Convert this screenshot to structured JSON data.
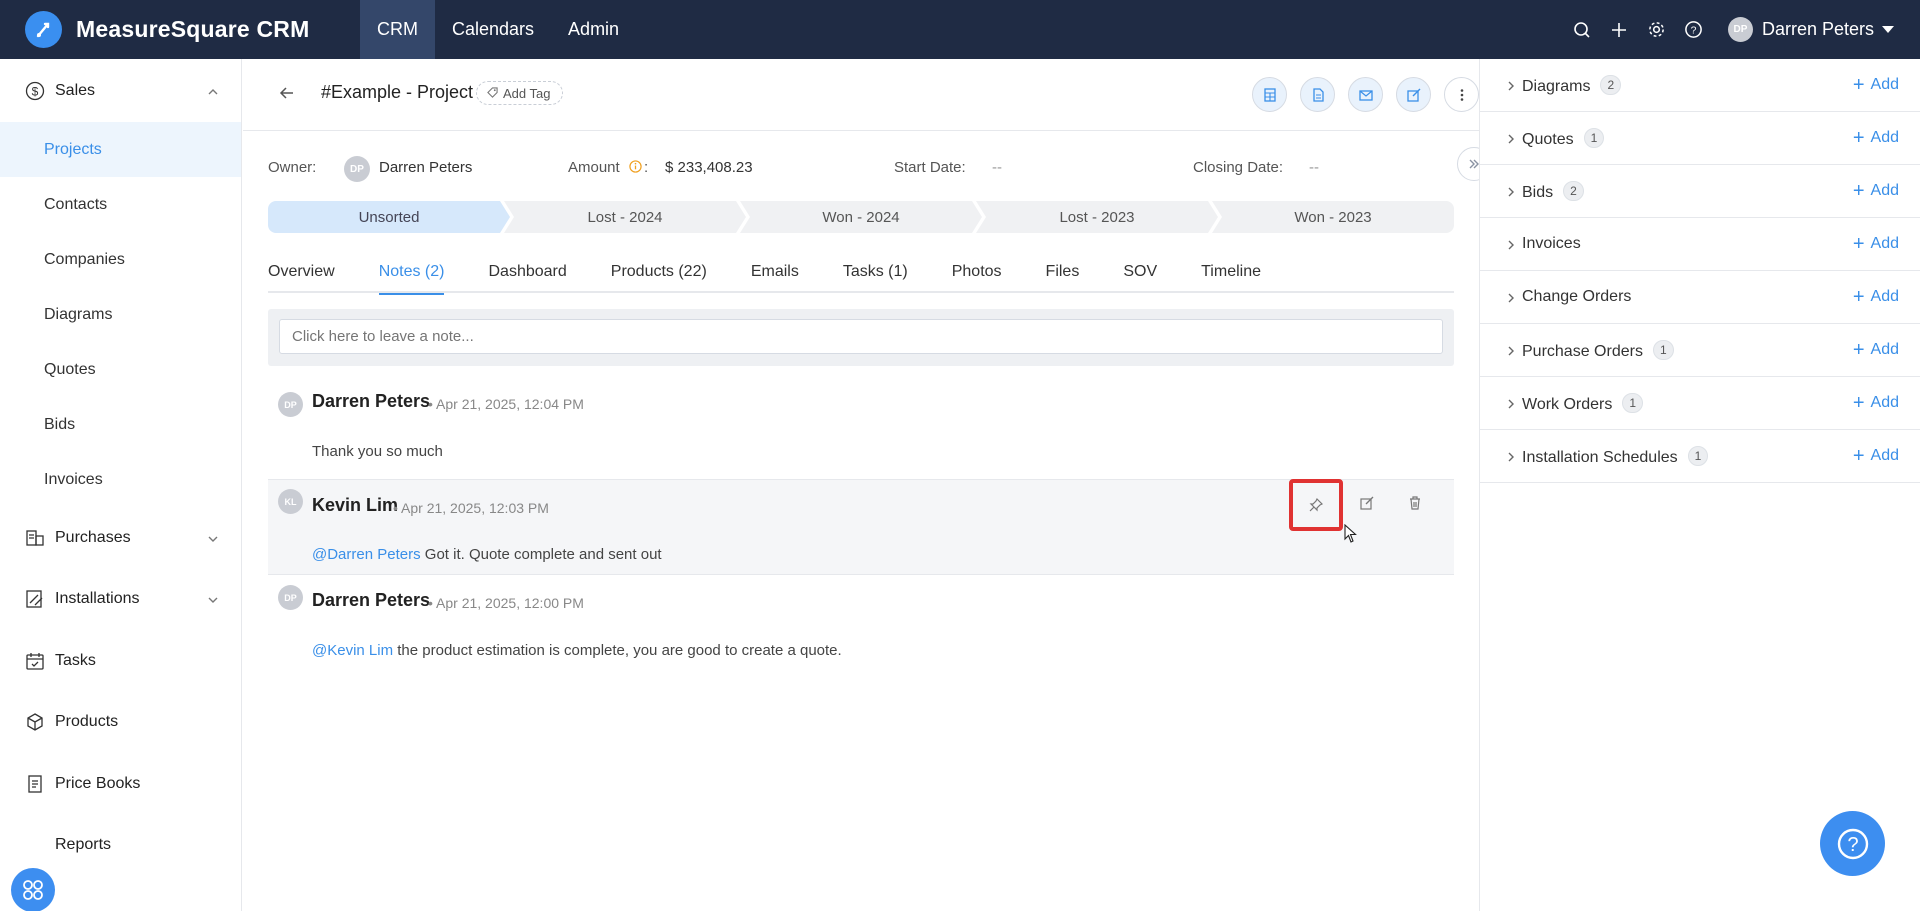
{
  "app": {
    "name": "MeasureSquare CRM"
  },
  "topnav": [
    {
      "label": "CRM",
      "active": true
    },
    {
      "label": "Calendars"
    },
    {
      "label": "Admin"
    }
  ],
  "user": {
    "name": "Darren Peters",
    "initials": "DP"
  },
  "sidebar": {
    "sales_label": "Sales",
    "sales_items": [
      "Projects",
      "Contacts",
      "Companies",
      "Diagrams",
      "Quotes",
      "Bids",
      "Invoices"
    ],
    "active_item": "Projects",
    "groups": [
      "Purchases",
      "Installations",
      "Tasks",
      "Products",
      "Price Books",
      "Reports"
    ]
  },
  "project": {
    "title": "#Example - Project",
    "add_tag": "Add Tag",
    "owner_label": "Owner:",
    "owner_initials": "DP",
    "owner_name": "Darren Peters",
    "amount_label": "Amount",
    "amount_colon": ":",
    "amount_value": "$ 233,408.23",
    "start_label": "Start Date:",
    "start_value": "--",
    "closing_label": "Closing Date:",
    "closing_value": "--"
  },
  "pipeline": [
    "Unsorted",
    "Lost - 2024",
    "Won - 2024",
    "Lost - 2023",
    "Won - 2023"
  ],
  "tabs": [
    "Overview",
    "Notes (2)",
    "Dashboard",
    "Products (22)",
    "Emails",
    "Tasks (1)",
    "Photos",
    "Files",
    "SOV",
    "Timeline"
  ],
  "note_input": {
    "placeholder": "Click here to leave a note..."
  },
  "notes": [
    {
      "initials": "DP",
      "author": "Darren Peters",
      "time": "Apr 21, 2025, 12:04 PM",
      "mention": "",
      "text": "Thank you so much"
    },
    {
      "initials": "KL",
      "author": "Kevin Lim",
      "time": "Apr 21, 2025, 12:03 PM",
      "mention": "@Darren Peters",
      "text": " Got it. Quote complete and sent out"
    },
    {
      "initials": "DP",
      "author": "Darren Peters",
      "time": "Apr 21, 2025, 12:00 PM",
      "mention": "@Kevin Lim",
      "text": " the product estimation is complete, you are good to create a quote."
    }
  ],
  "right_panel": {
    "add_label": "Add",
    "rows": [
      {
        "label": "Diagrams",
        "count": "2"
      },
      {
        "label": "Quotes",
        "count": "1"
      },
      {
        "label": "Bids",
        "count": "2"
      },
      {
        "label": "Invoices",
        "count": ""
      },
      {
        "label": "Change Orders",
        "count": ""
      },
      {
        "label": "Purchase Orders",
        "count": "1"
      },
      {
        "label": "Work Orders",
        "count": "1"
      },
      {
        "label": "Installation Schedules",
        "count": "1"
      }
    ]
  },
  "colors": {
    "topbar": "#1f2b44",
    "accent": "#3a8fe8",
    "highlight_box": "#e03232"
  }
}
